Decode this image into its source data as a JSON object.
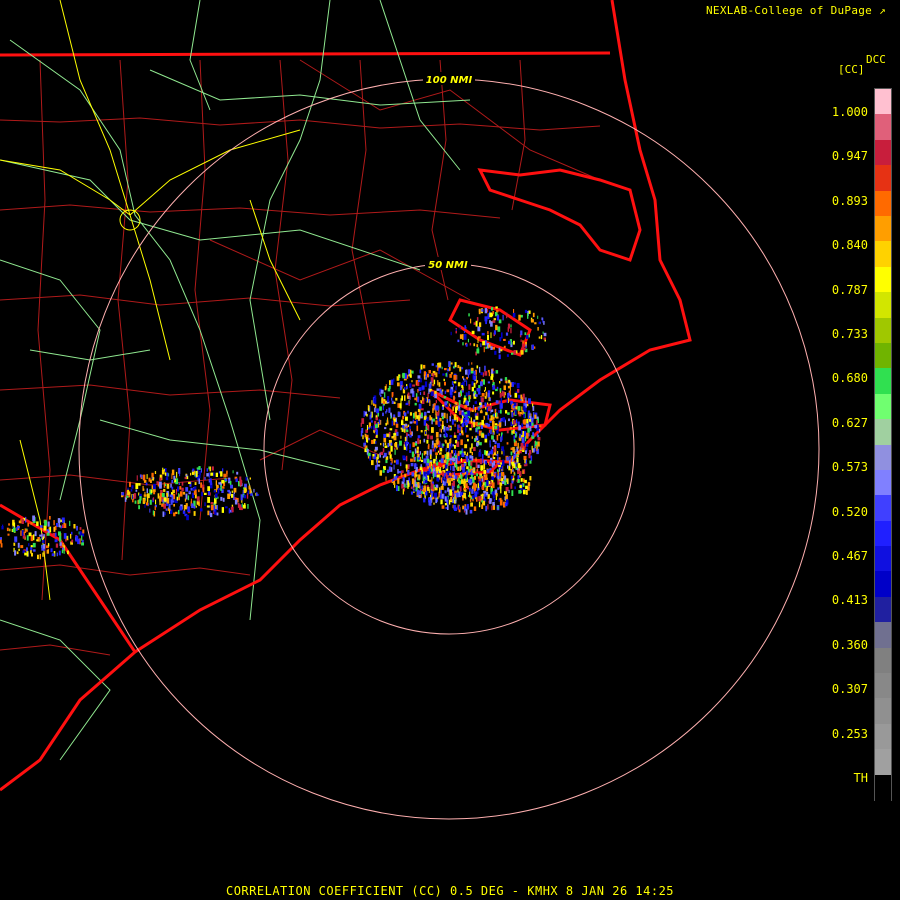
{
  "credit": "NEXLAB-College of DuPage",
  "credit_icon": "external-link-icon",
  "legend": {
    "title_top": "DCC",
    "title_unit": "[CC]",
    "ticks": [
      "1.000",
      "0.947",
      "0.893",
      "0.840",
      "0.787",
      "0.733",
      "0.680",
      "0.627",
      "0.573",
      "0.520",
      "0.467",
      "0.413",
      "0.360",
      "0.307",
      "0.253",
      "TH"
    ],
    "colors": [
      "#ffc0d0",
      "#e0607a",
      "#c81e3c",
      "#e63214",
      "#ff6a00",
      "#ff9e00",
      "#ffd200",
      "#ffff00",
      "#d2e600",
      "#a0c800",
      "#70b400",
      "#30e050",
      "#70ff70",
      "#a0d0a0",
      "#9090e0",
      "#8080ff",
      "#4040ff",
      "#2020ff",
      "#1010e0",
      "#0000c8",
      "#2020a0",
      "#707090",
      "#808080",
      "#888888",
      "#909090",
      "#999999",
      "#a0a0a0",
      "#000000"
    ]
  },
  "rings": {
    "inner_label": "50 NMI",
    "outer_label": "100 NMI"
  },
  "footer": "CORRELATION COEFFICIENT (CC) 0.5 DEG - KMHX 8 JAN 26 14:25",
  "colors": {
    "text": "#ffff00",
    "coast": "#ff0000",
    "county": "#c81e1e",
    "roads": "#90e890",
    "interstate": "#ffff00",
    "ring": "#ffb0b0"
  }
}
